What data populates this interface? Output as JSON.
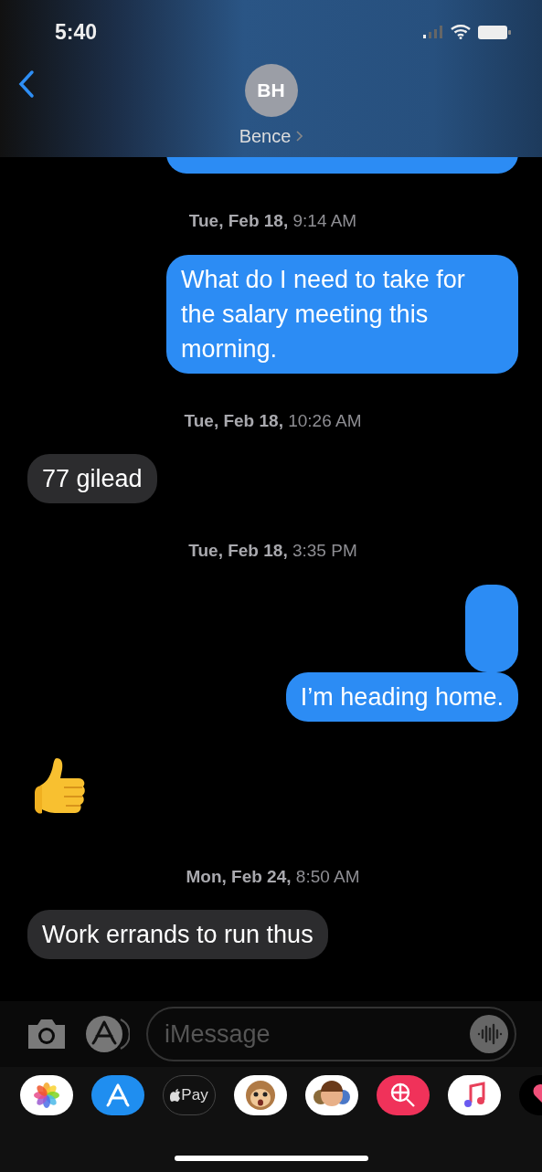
{
  "status_bar": {
    "time": "5:40"
  },
  "header": {
    "initials": "BH",
    "name": "Bence"
  },
  "messages": [
    {
      "kind": "sent",
      "cut": true
    },
    {
      "kind": "timestamp",
      "text": "**Tue, Feb 18,** 9:14 AM"
    },
    {
      "kind": "sent",
      "text": "What do I need to take for the salary meeting this morning."
    },
    {
      "kind": "timestamp",
      "text": "**Tue, Feb 18,** 10:26 AM"
    },
    {
      "kind": "received",
      "text": "77 gilead"
    },
    {
      "kind": "timestamp",
      "text": "**Tue, Feb 18,** 3:35 PM"
    },
    {
      "kind": "sent"
    },
    {
      "kind": "sent",
      "text": "I’m heading home."
    },
    {
      "kind": "thumb"
    },
    {
      "kind": "timestamp",
      "text": "**Mon, Feb 24,** 8:50 AM"
    },
    {
      "kind": "received",
      "text": "Work errands to run thus"
    }
  ],
  "composer": {
    "placeholder": "iMessage"
  },
  "app_drawer": [
    {
      "kind": "photos"
    },
    {
      "kind": "appstore"
    },
    {
      "kind": "pay",
      "label": "Pay"
    },
    {
      "kind": "monkey"
    },
    {
      "kind": "memoji"
    },
    {
      "kind": "search"
    },
    {
      "kind": "music"
    },
    {
      "kind": "heart"
    }
  ]
}
